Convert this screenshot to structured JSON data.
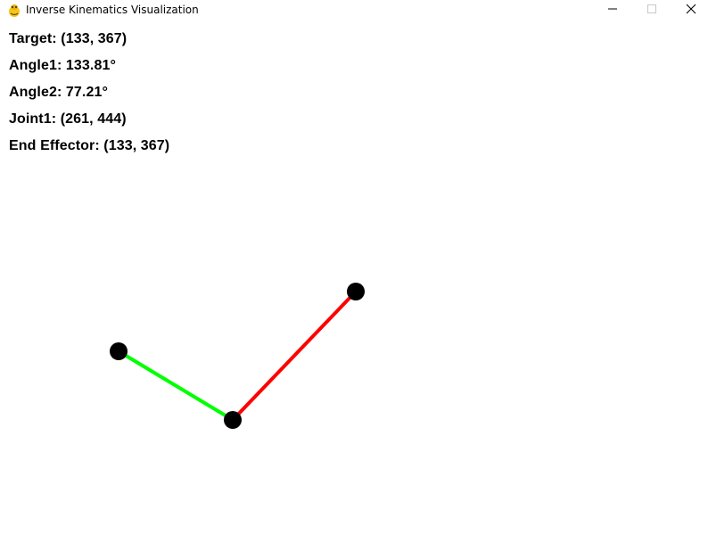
{
  "window": {
    "title": "Inverse Kinematics Visualization",
    "icon": "pygame-snake-icon",
    "controls": {
      "minimize": "minimize-icon",
      "maximize": "maximize-icon",
      "close": "close-icon"
    }
  },
  "info": {
    "target": "Target: (133, 367)",
    "angle1": "Angle1: 133.81°",
    "angle2": "Angle2: 77.21°",
    "joint1": "Joint1: (261, 444)",
    "end_effector": "End Effector: (133, 367)"
  },
  "colors": {
    "background": "#ffffff",
    "segment1": "#ff0000",
    "segment2": "#00ff00",
    "joints": "#000000"
  }
}
